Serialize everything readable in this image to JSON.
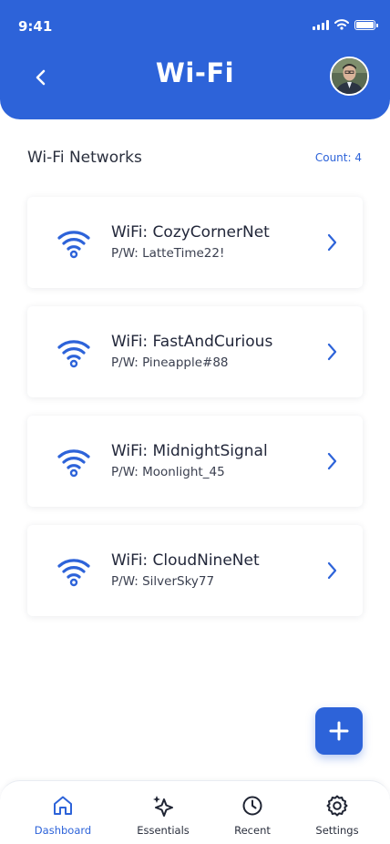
{
  "status_bar": {
    "time": "9:41"
  },
  "header": {
    "title": "Wi-Fi",
    "back_icon": "chevron-left-icon",
    "avatar": "user-avatar"
  },
  "section": {
    "title": "Wi-Fi Networks",
    "count": "Count: 4"
  },
  "networks": [
    {
      "ssid": "WiFi: CozyCornerNet",
      "password": "P/W: LatteTime22!"
    },
    {
      "ssid": "WiFi: FastAndCurious",
      "password": "P/W: Pineapple#88"
    },
    {
      "ssid": "WiFi: MidnightSignal",
      "password": "P/W: Moonlight_45"
    },
    {
      "ssid": "WiFi: CloudNineNet",
      "password": "P/W: SilverSky77"
    }
  ],
  "fab": {
    "icon": "plus-icon"
  },
  "bottom_nav": [
    {
      "label": "Dashboard",
      "icon": "home-icon",
      "active": true
    },
    {
      "label": "Essentials",
      "icon": "sparkle-icon",
      "active": false
    },
    {
      "label": "Recent",
      "icon": "clock-icon",
      "active": false
    },
    {
      "label": "Settings",
      "icon": "gear-icon",
      "active": false
    }
  ],
  "colors": {
    "primary": "#2d63d9",
    "text": "#22273a",
    "background": "#ffffff"
  }
}
